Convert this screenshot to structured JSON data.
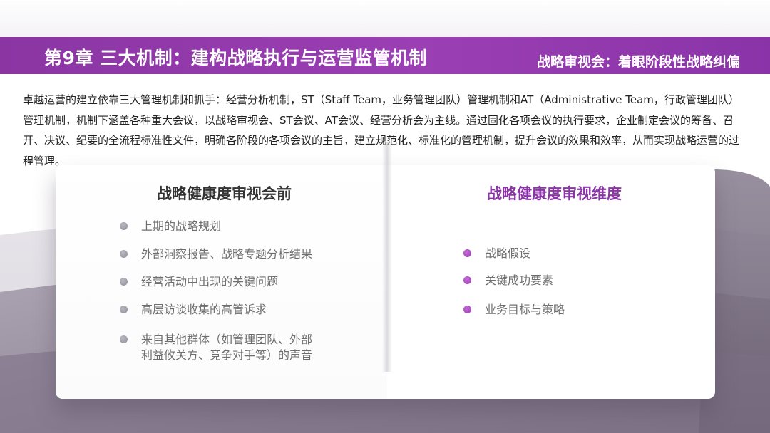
{
  "header": {
    "chapter_title": "第9章 三大机制：建构战略执行与运营监管机制",
    "section_subtitle": "战略审视会：着眼阶段性战略纠偏"
  },
  "intro": {
    "text": "卓越运营的建立依靠三大管理机制和抓手：经营分析机制，ST（Staff Team，业务管理团队）管理机制和AT（Administrative Team，行政管理团队）管理机制，机制下涵盖各种重大会议，以战略审视会、ST会议、AT会议、经营分析会为主线。通过固化各项会议的执行要求，企业制定会议的筹备、召开、决议、纪要的全流程标准性文件，明确各阶段的各项会议的主旨，建立规范化、标准化的管理机制，提升会议的效果和效率，从而实现战略运营的过程管理。"
  },
  "left_column": {
    "heading": "战略健康度审视会前",
    "items": [
      {
        "line1": "上期的战略规划",
        "line2": ""
      },
      {
        "line1": "外部洞察报告、战略专题分析结果",
        "line2": ""
      },
      {
        "line1": "经营活动中出现的关键问题",
        "line2": ""
      },
      {
        "line1": "高层访谈收集的高管诉求",
        "line2": ""
      },
      {
        "line1": "来自其他群体（如管理团队、外部",
        "line2": "利益攸关方、竞争对手等）的声音"
      }
    ]
  },
  "right_column": {
    "heading": "战略健康度审视维度",
    "items": [
      {
        "line1": "战略假设"
      },
      {
        "line1": "关键成功要素"
      },
      {
        "line1": "业务目标与策略"
      }
    ]
  },
  "colors": {
    "brand_purple": "#8b35a3",
    "heading_purple": "#8a35a6",
    "bullet_gray": "#8d8d98",
    "bullet_purple": "#9a3cb5"
  }
}
